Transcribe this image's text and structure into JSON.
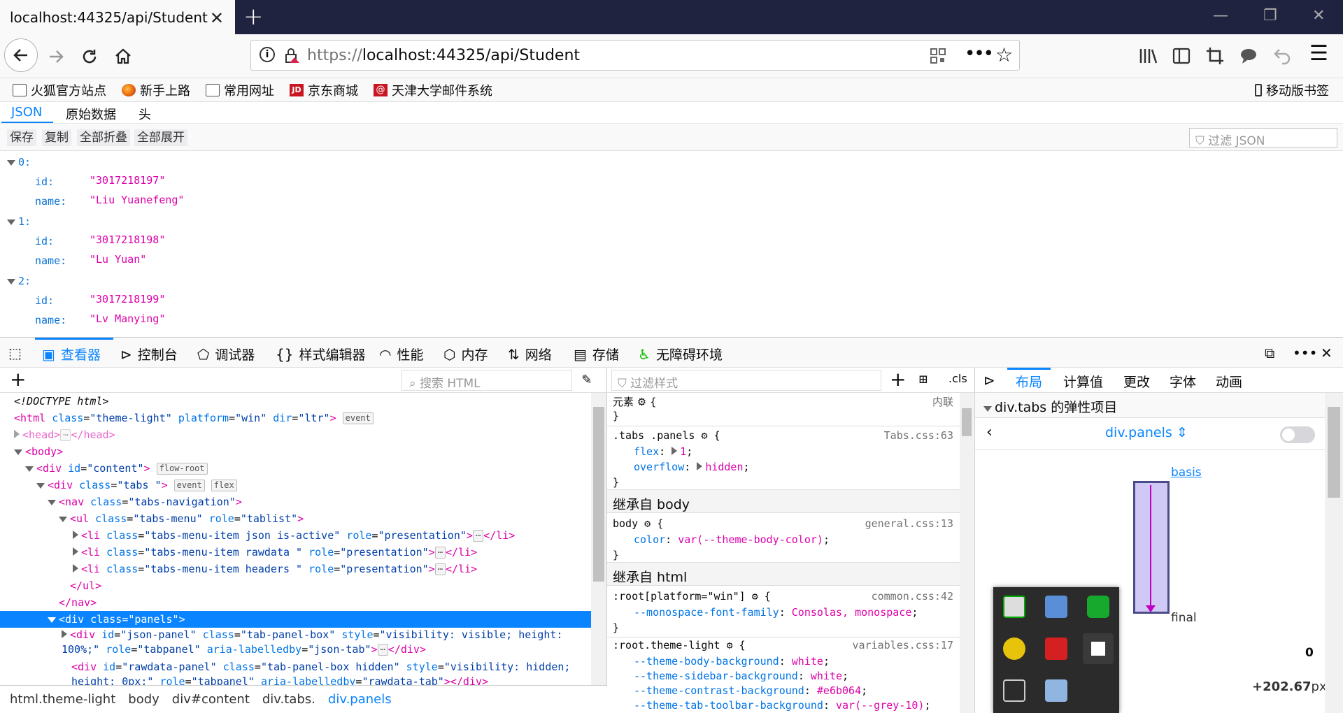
{
  "browser": {
    "tab_title": "localhost:44325/api/Student",
    "url_prefix": "https://",
    "url_host": "localhost",
    "url_rest": ":44325/api/Student",
    "mobile_bookmarks": "移动版书签"
  },
  "bookmarks": [
    {
      "label": "火狐官方站点",
      "icon": "folder-icon"
    },
    {
      "label": "新手上路",
      "icon": "firefox-icon"
    },
    {
      "label": "常用网址",
      "icon": "folder-icon"
    },
    {
      "label": "京东商城",
      "icon": "jd-icon"
    },
    {
      "label": "天津大学邮件系统",
      "icon": "mail-icon"
    }
  ],
  "viewer": {
    "tabs": [
      "JSON",
      "原始数据",
      "头"
    ],
    "toolbar": [
      "保存",
      "复制",
      "全部折叠",
      "全部展开"
    ],
    "filter_placeholder": "过滤 JSON"
  },
  "json_items": [
    {
      "index": "0:",
      "id_key": "id:",
      "id": "\"3017218197\"",
      "name_key": "name:",
      "name": "\"Liu Yuanefeng\""
    },
    {
      "index": "1:",
      "id_key": "id:",
      "id": "\"3017218198\"",
      "name_key": "name:",
      "name": "\"Lu Yuan\""
    },
    {
      "index": "2:",
      "id_key": "id:",
      "id": "\"3017218199\"",
      "name_key": "name:",
      "name": "\"Lv Manying\""
    }
  ],
  "devtools": {
    "tabs": [
      "查看器",
      "控制台",
      "调试器",
      "样式编辑器",
      "性能",
      "内存",
      "网络",
      "存储",
      "无障碍环境"
    ],
    "search_html_placeholder": "搜索 HTML",
    "filter_styles_placeholder": "过滤样式",
    "cls_label": ".cls"
  },
  "markup": {
    "doctype": "<!DOCTYPE html>",
    "event_badge": "event",
    "flex_badge": "flex",
    "flowroot_badge": "flow-root",
    "ellipsis": "⋯"
  },
  "breadcrumb": [
    "html.theme-light",
    "body",
    "div#content",
    "div.tabs.",
    "div.panels"
  ],
  "rules": {
    "element_label": "元素",
    "inline_label": "内联",
    "tabs_selector": ".tabs .panels",
    "tabs_source": "Tabs.css:63",
    "flex_prop": "flex",
    "flex_val": "1",
    "overflow_prop": "overflow",
    "overflow_val": "hidden",
    "inherited_body": "继承自 body",
    "body_selector": "body",
    "body_source": "general.css:13",
    "color_prop": "color",
    "color_val": "var(--theme-body-color)",
    "inherited_html": "继承自 html",
    "root_selector": ":root[platform=\"win\"]",
    "root_source": "common.css:42",
    "mono_prop": "--monospace-font-family",
    "mono_val": "Consolas, monospace",
    "theme_selector": ":root.theme-light",
    "theme_source": "variables.css:17",
    "theme_vars": [
      {
        "prop": "--theme-body-background",
        "val": "white"
      },
      {
        "prop": "--theme-sidebar-background",
        "val": "white"
      },
      {
        "prop": "--theme-contrast-background",
        "val": "#e6b064"
      },
      {
        "prop": "--theme-tab-toolbar-background",
        "val": "var(--grey-10)"
      }
    ]
  },
  "layout": {
    "tabs": [
      "布局",
      "计算值",
      "更改",
      "字体",
      "动画"
    ],
    "flex_header": "div.tabs 的弹性项目",
    "flex_item": "div.panels",
    "basis_label": "basis",
    "final_label": "final",
    "zero_value": "0",
    "delta_value": "+202.67",
    "delta_unit": "px"
  },
  "colors": {
    "accent": "#0a84ff",
    "tab_strip": "#202340",
    "tag": "#dd00a9",
    "attr": "#0074e8"
  }
}
